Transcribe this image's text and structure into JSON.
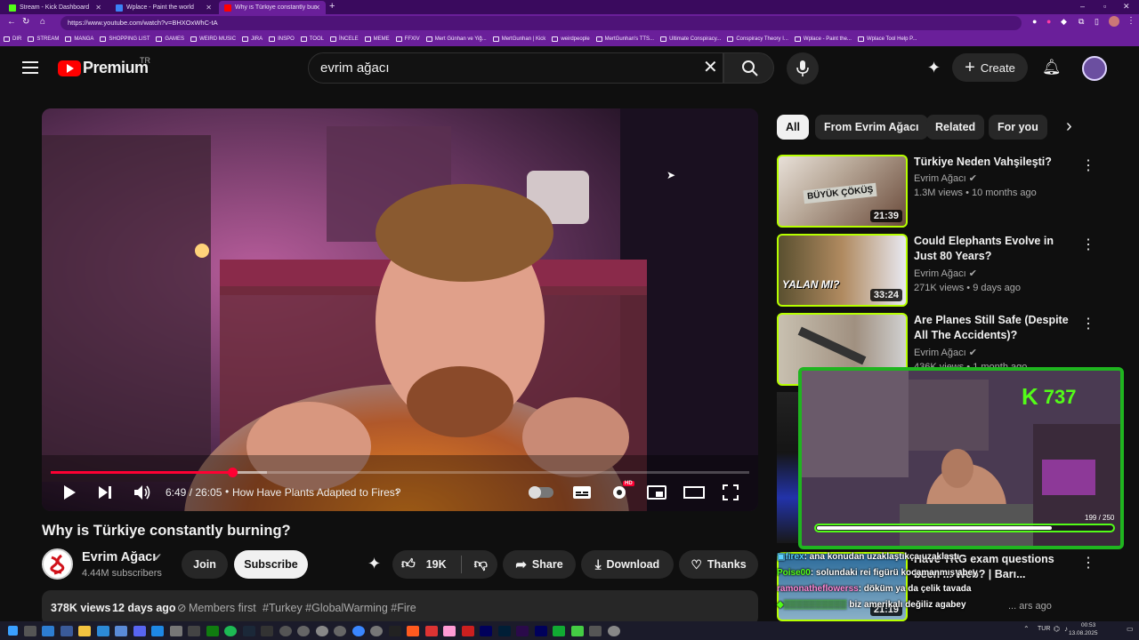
{
  "browser": {
    "tabs": [
      {
        "title": "Stream - Kick Dashboard",
        "fav": "#53fc18"
      },
      {
        "title": "Wplace - Paint the world",
        "fav": "#3b82f6"
      },
      {
        "title": "Why is Türkiye constantly burnin...",
        "fav": "#ff0000"
      }
    ],
    "url": "https://www.youtube.com/watch?v=BHXOxWhC-tA",
    "bookmarks": [
      "DIR",
      "STREAM",
      "MANGA",
      "SHOPPING LIST",
      "GAMES",
      "WEIRD MUSIC",
      "JIRA",
      "INSPO",
      "TOOL",
      "İNCELE",
      "MEME",
      "FFXIV",
      "Mert Günhan ve Yiğ...",
      "MertGunhan | Kick",
      "weirdpeople",
      "MertGunhan's TTS...",
      "Ultimate Conspiracy...",
      "Conspiracy Theory I...",
      "Wplace - Paint the...",
      "Wplace Tool Help P..."
    ]
  },
  "header": {
    "logo": "Premium",
    "region": "TR",
    "search_value": "evrim ağacı",
    "create_label": "Create"
  },
  "player": {
    "time": "6:49 / 26:05",
    "chapter": "How Have Plants Adapted to Fires?",
    "progress": 0.26,
    "buffered": 0.31,
    "hd_badge": "HD"
  },
  "video": {
    "title": "Why is Türkiye constantly burning?",
    "channel": "Evrim Ağacı",
    "subscribers": "4.44M subscribers",
    "join": "Join",
    "subscribe": "Subscribe",
    "likes": "19K",
    "share": "Share",
    "download": "Download",
    "thanks": "Thanks",
    "views": "378K views",
    "age": "12 days ago",
    "members": "Members first",
    "tags": "#Turkey #GlobalWarming #Fire"
  },
  "chips": [
    "All",
    "From Evrim Ağacı",
    "Related",
    "For you"
  ],
  "recommendations": [
    {
      "title": "Türkiye Neden Vahşileşti?",
      "channel": "Evrim Ağacı",
      "meta": "1.3M views • 10 months ago",
      "duration": "21:39"
    },
    {
      "title": "Could Elephants Evolve in Just 80 Years?",
      "channel": "Evrim Ağacı",
      "meta": "271K views • 9 days ago",
      "duration": "33:24"
    },
    {
      "title": "Are Planes Still Safe (Despite All The Accidents)?",
      "channel": "Evrim Ağacı",
      "meta": "436K views • 1 month ago",
      "duration": ""
    },
    {
      "title": "Have TRG exam questions been ... Web? | Barı...",
      "channel": "",
      "meta": "... ars ago",
      "duration": "21:19"
    }
  ],
  "stream_overlay": {
    "viewer_count": "737",
    "progress_text": "199 / 250",
    "progress": 0.796
  },
  "chat": [
    {
      "user": "firex",
      "text": ": ana konudan uzaklaştıkça uzaklaştı"
    },
    {
      "user": "Poise00",
      "text": ": solundaki rei figürü kocamanmış abey"
    },
    {
      "user": "ramonatheflowerss",
      "text": ": döküm ya da çelik tavada"
    },
    {
      "user": "",
      "text": "biz amerikalı değiliz agabey"
    }
  ],
  "system": {
    "lang": "TUR",
    "time": "00:53",
    "date": "13.08.2025"
  }
}
